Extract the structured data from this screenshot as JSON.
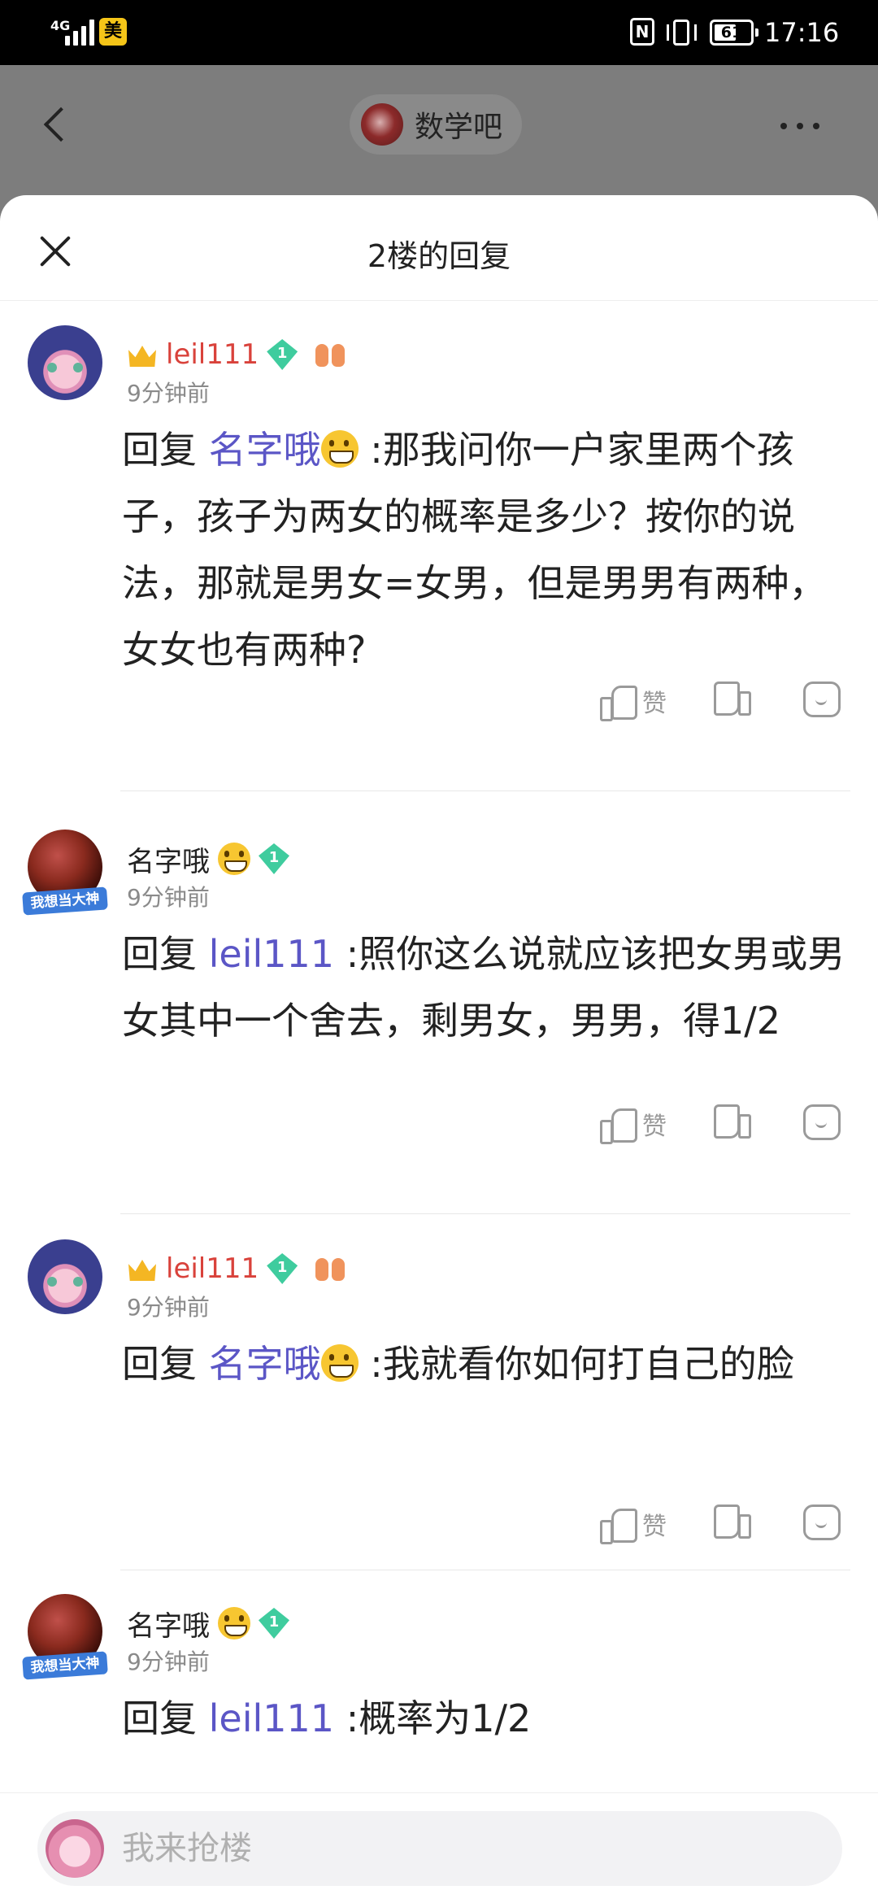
{
  "status_bar": {
    "network": "4G",
    "carrier_badge": "美",
    "nfc": "N",
    "battery": "61",
    "time": "17:16"
  },
  "header": {
    "forum_name": "数学吧"
  },
  "sheet": {
    "title": "2楼的回复"
  },
  "comments": [
    {
      "username": "leil111",
      "level": "1",
      "time": "9分钟前",
      "reply_prefix": "回复",
      "reply_to": "名字哦",
      "text": ":那我问你一户家里两个孩子，孩子为两女的概率是多少？按你的说法，那就是男女=女男，但是男男有两种，女女也有两种?",
      "like_label": "赞"
    },
    {
      "username": "名字哦",
      "avatar_tag": "我想当大神",
      "level": "1",
      "time": "9分钟前",
      "reply_prefix": "回复",
      "reply_to": "leil111",
      "text": ":照你这么说就应该把女男或男女其中一个舍去，剩男女，男男，得1/2",
      "like_label": "赞"
    },
    {
      "username": "leil111",
      "level": "1",
      "time": "9分钟前",
      "reply_prefix": "回复",
      "reply_to": "名字哦",
      "text": ":我就看你如何打自己的脸",
      "like_label": "赞"
    },
    {
      "username": "名字哦",
      "avatar_tag": "我想当大神",
      "level": "1",
      "time": "9分钟前",
      "reply_prefix": "回复",
      "reply_to": "leil111",
      "text": ":概率为1/2"
    }
  ],
  "input": {
    "placeholder": "我来抢楼"
  },
  "battery_level": 0.61,
  "colors": {
    "mention": "#5b56c6",
    "username_red": "#d9423b",
    "level_badge": "#3fcc9e",
    "status_badge": "#f5c518"
  }
}
